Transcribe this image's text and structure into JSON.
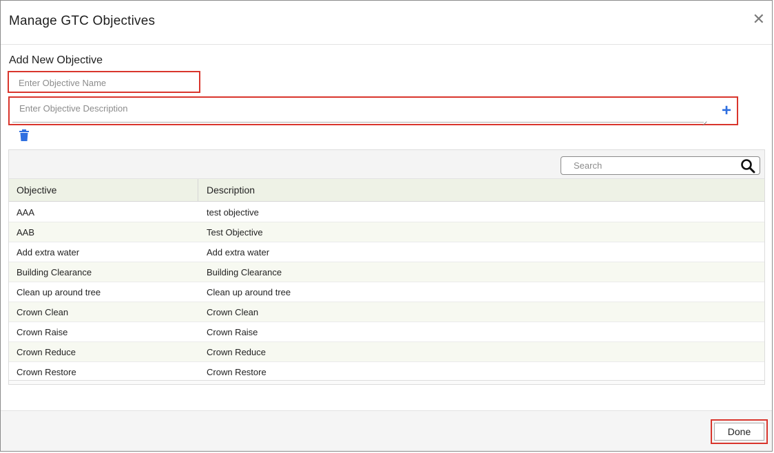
{
  "modal": {
    "title": "Manage GTC Objectives",
    "close_icon": "close-icon"
  },
  "form": {
    "section_title": "Add New Objective",
    "name_placeholder": "Enter Objective Name",
    "description_placeholder": "Enter Objective Description",
    "add_icon": "plus-icon",
    "delete_icon": "trash-icon"
  },
  "grid": {
    "search_placeholder": "Search",
    "search_icon": "search-icon",
    "columns": [
      "Objective",
      "Description"
    ],
    "rows": [
      {
        "objective": "AAA",
        "description": "test objective"
      },
      {
        "objective": "AAB",
        "description": "Test Objective"
      },
      {
        "objective": "Add extra water",
        "description": "Add extra water"
      },
      {
        "objective": "Building Clearance",
        "description": "Building Clearance"
      },
      {
        "objective": "Clean up around tree",
        "description": "Clean up around tree"
      },
      {
        "objective": "Crown Clean",
        "description": "Crown Clean"
      },
      {
        "objective": "Crown Raise",
        "description": "Crown Raise"
      },
      {
        "objective": "Crown Reduce",
        "description": "Crown Reduce"
      },
      {
        "objective": "Crown Restore",
        "description": "Crown Restore"
      }
    ]
  },
  "footer": {
    "done_label": "Done"
  },
  "colors": {
    "highlight": "#d9352c",
    "accent": "#2f6fe0",
    "header_row_bg": "#eef2e6"
  }
}
